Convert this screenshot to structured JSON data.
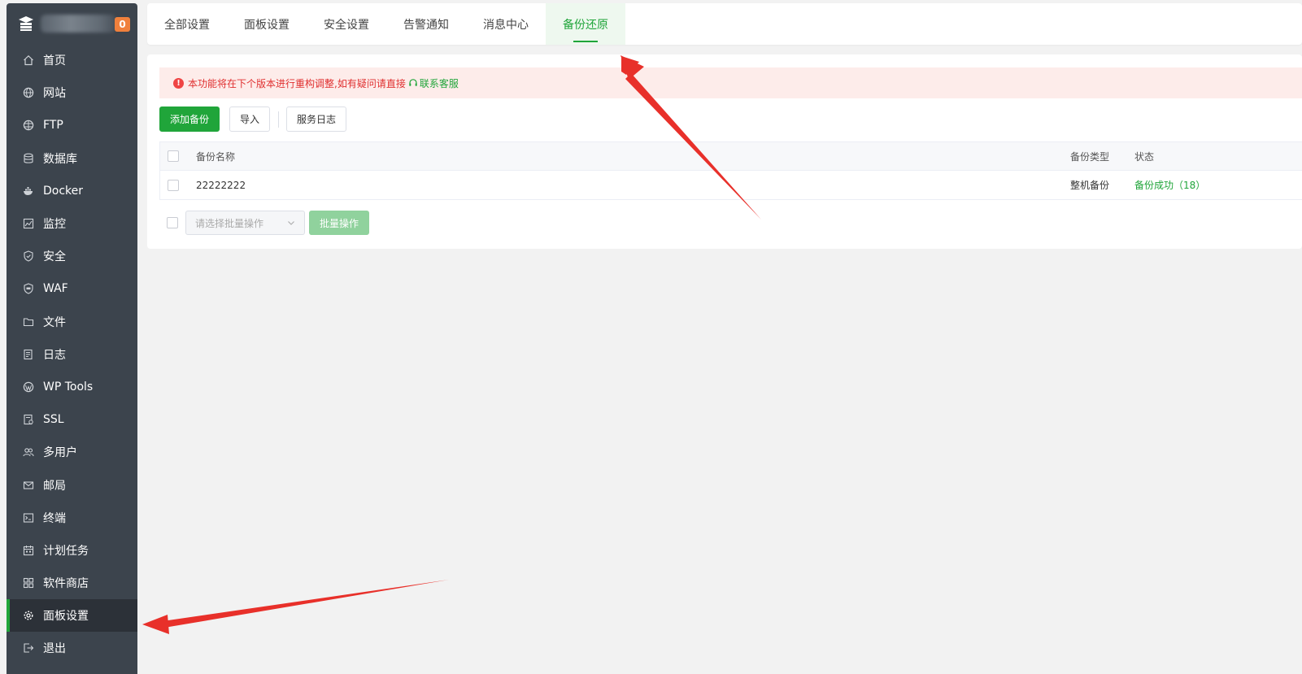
{
  "brand": {
    "badge_count": "0",
    "logo_icon": "server-logo-icon"
  },
  "sidebar": {
    "items": [
      {
        "label": "首页",
        "icon": "home-icon"
      },
      {
        "label": "网站",
        "icon": "globe-icon"
      },
      {
        "label": "FTP",
        "icon": "ftp-icon"
      },
      {
        "label": "数据库",
        "icon": "database-icon"
      },
      {
        "label": "Docker",
        "icon": "docker-icon"
      },
      {
        "label": "监控",
        "icon": "monitor-icon"
      },
      {
        "label": "安全",
        "icon": "shield-icon"
      },
      {
        "label": "WAF",
        "icon": "waf-icon"
      },
      {
        "label": "文件",
        "icon": "folder-icon"
      },
      {
        "label": "日志",
        "icon": "log-icon"
      },
      {
        "label": "WP Tools",
        "icon": "wordpress-icon"
      },
      {
        "label": "SSL",
        "icon": "ssl-icon"
      },
      {
        "label": "多用户",
        "icon": "users-icon"
      },
      {
        "label": "邮局",
        "icon": "mail-icon"
      },
      {
        "label": "终端",
        "icon": "terminal-icon"
      },
      {
        "label": "计划任务",
        "icon": "calendar-icon"
      },
      {
        "label": "软件商店",
        "icon": "apps-icon"
      },
      {
        "label": "面板设置",
        "icon": "gear-icon",
        "active": true
      },
      {
        "label": "退出",
        "icon": "logout-icon"
      }
    ]
  },
  "tabs": [
    {
      "label": "全部设置"
    },
    {
      "label": "面板设置"
    },
    {
      "label": "安全设置"
    },
    {
      "label": "告警通知"
    },
    {
      "label": "消息中心"
    },
    {
      "label": "备份还原",
      "active": true
    }
  ],
  "alert": {
    "text": "本功能将在下个版本进行重构调整,如有疑问请直接",
    "link_label": "联系客服"
  },
  "toolbar": {
    "add_label": "添加备份",
    "import_label": "导入",
    "log_label": "服务日志"
  },
  "table": {
    "headers": {
      "name": "备份名称",
      "type": "备份类型",
      "status": "状态"
    },
    "rows": [
      {
        "name": "22222222",
        "type": "整机备份",
        "status": "备份成功（18）"
      }
    ]
  },
  "batch": {
    "select_placeholder": "请选择批量操作",
    "button_label": "批量操作"
  },
  "colors": {
    "accent": "#20a53a",
    "sidebar_bg": "#3c444d",
    "alert_bg": "#fdecea",
    "alert_text": "#e03030",
    "annotation": "#e8302a"
  }
}
